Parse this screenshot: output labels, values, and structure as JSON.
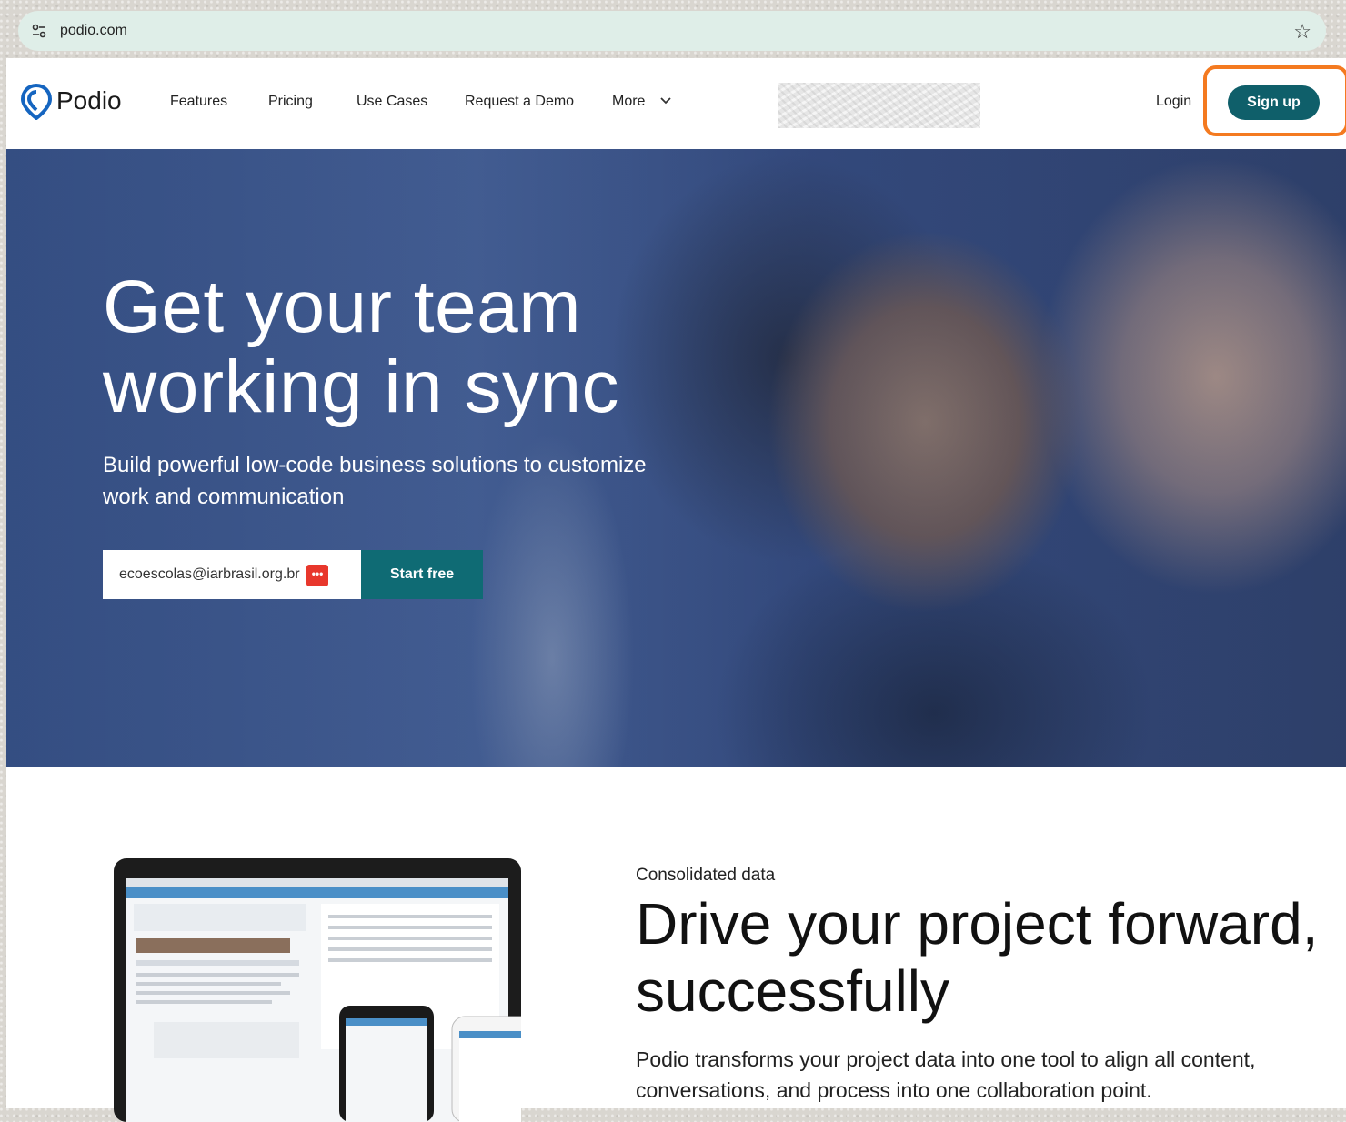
{
  "browser": {
    "url": "podio.com"
  },
  "nav": {
    "logo": "Podio",
    "items": [
      "Features",
      "Pricing",
      "Use Cases",
      "Request a Demo",
      "More"
    ],
    "login": "Login",
    "signup": "Sign up"
  },
  "hero": {
    "title_line1": "Get your team",
    "title_line2": "working in sync",
    "subtitle": "Build powerful low-code business solutions to customize work and communication",
    "email_value": "ecoescolas@iarbrasil.org.br",
    "cta": "Start free"
  },
  "feature": {
    "eyebrow": "Consolidated data",
    "title": "Drive your project forward, successfully",
    "description": "Podio transforms your project data into one tool to align all content, conversations, and process into one collaboration point."
  },
  "colors": {
    "brand_teal": "#0f5f6a",
    "highlight_orange": "#f47a20",
    "address_bar": "#dfeee8"
  }
}
